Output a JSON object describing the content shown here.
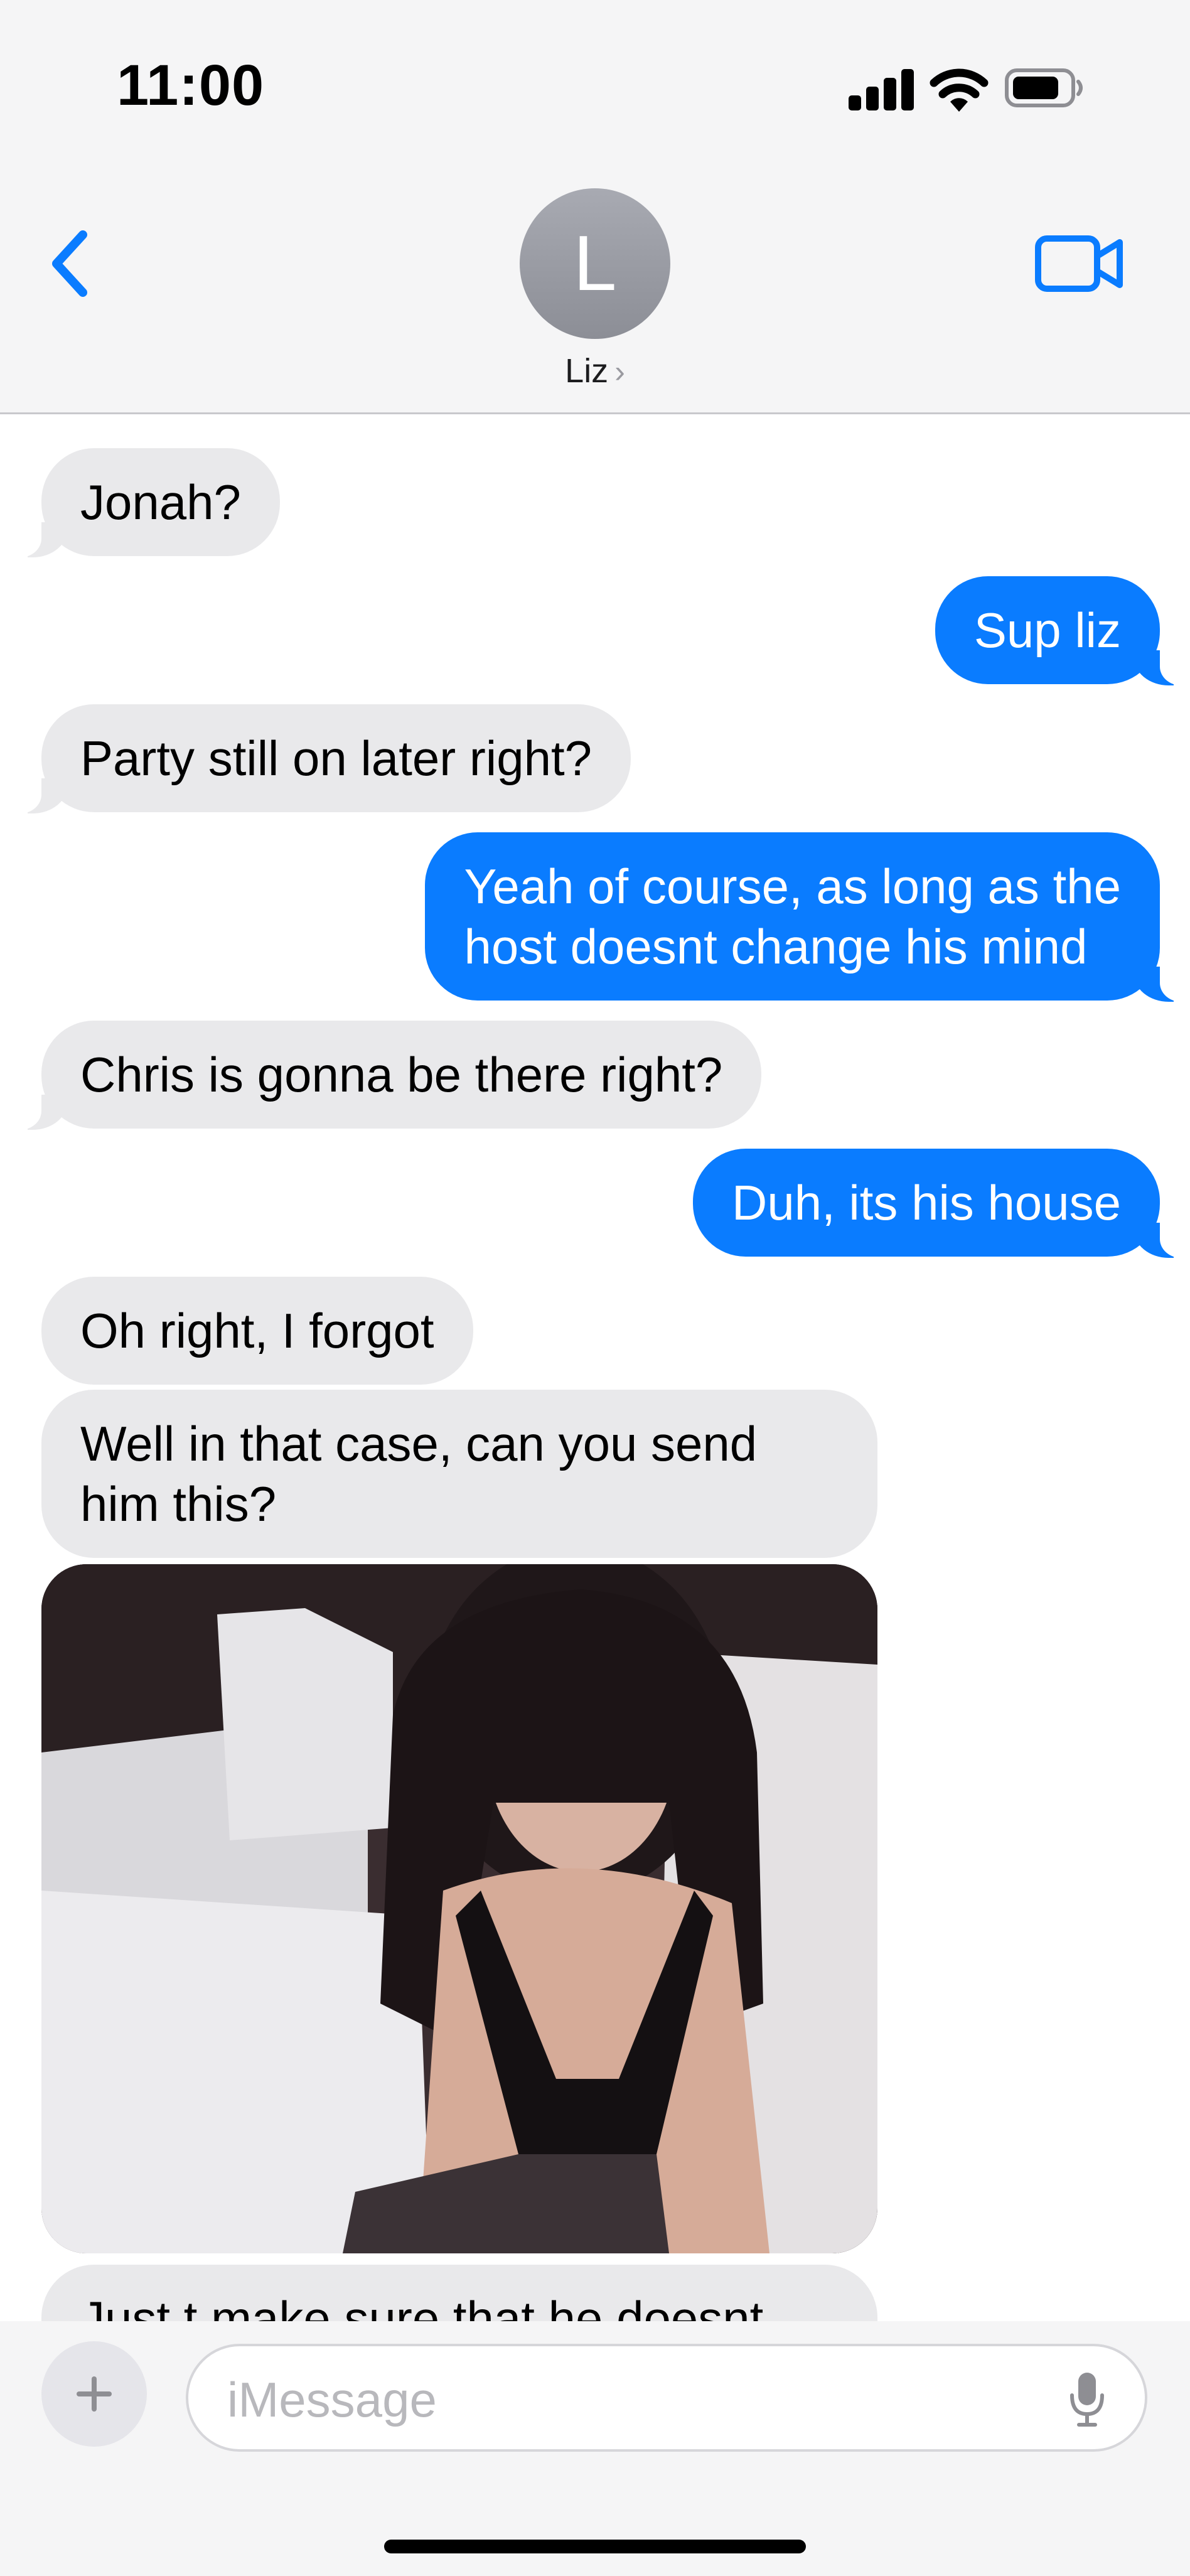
{
  "status_bar": {
    "time": "11:00"
  },
  "header": {
    "contact_initial": "L",
    "contact_name": "Liz",
    "contact_chevron": "›"
  },
  "messages": [
    {
      "from": "them",
      "text": "Jonah?"
    },
    {
      "from": "me",
      "text": "Sup liz"
    },
    {
      "from": "them",
      "text": "Party still on later right?"
    },
    {
      "from": "me",
      "lines": [
        "Yeah of course, as long as the",
        "host doesnt change his mind"
      ]
    },
    {
      "from": "them",
      "text": "Chris is gonna be there right?"
    },
    {
      "from": "me",
      "text": "Duh, its his house"
    },
    {
      "from": "them",
      "text": "Oh right, I forgot"
    },
    {
      "from": "them",
      "lines": [
        "Well in that case, can you send",
        "him this?"
      ]
    },
    {
      "from": "them",
      "type": "image"
    },
    {
      "from": "them",
      "text": "Just t make sure that he doesnt"
    }
  ],
  "composer": {
    "add": "+",
    "placeholder": "iMessage"
  },
  "colors": {
    "sent": "#0a7cff",
    "received": "#e9e9eb",
    "accent": "#0a7cff"
  }
}
